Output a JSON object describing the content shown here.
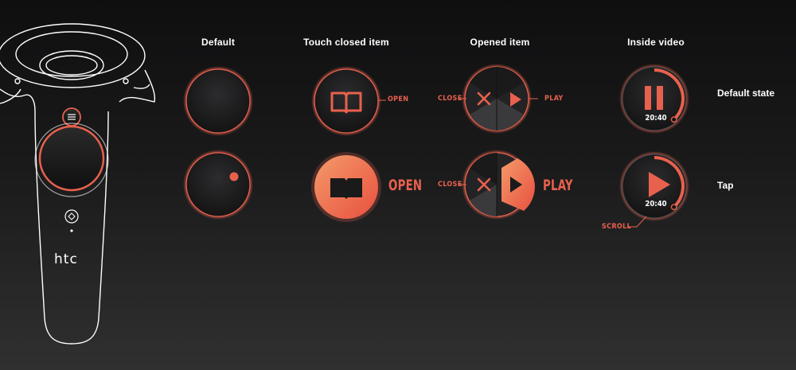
{
  "controller": {
    "brand": "htc"
  },
  "columns": {
    "default": "Default",
    "touch_closed": "Touch closed item",
    "opened": "Opened item",
    "inside_video": "Inside video"
  },
  "rows": {
    "default_state": "Default state",
    "tap": "Tap"
  },
  "labels": {
    "open": "OPEN",
    "close": "CLOSE",
    "play": "PLAY",
    "scroll": "SCROLL"
  },
  "video": {
    "time_default": "20:40",
    "time_tap": "20:40",
    "progress_default": 0.38,
    "progress_tap": 0.38
  },
  "colors": {
    "accent": "#e8614d",
    "accent_light": "#f07a5a",
    "background": "#111112",
    "outline": "#ffffff"
  },
  "icons": {
    "book": "book-icon",
    "close": "close-x-icon",
    "play": "play-icon",
    "pause": "pause-icon",
    "menu": "menu-icon",
    "system": "system-icon"
  }
}
